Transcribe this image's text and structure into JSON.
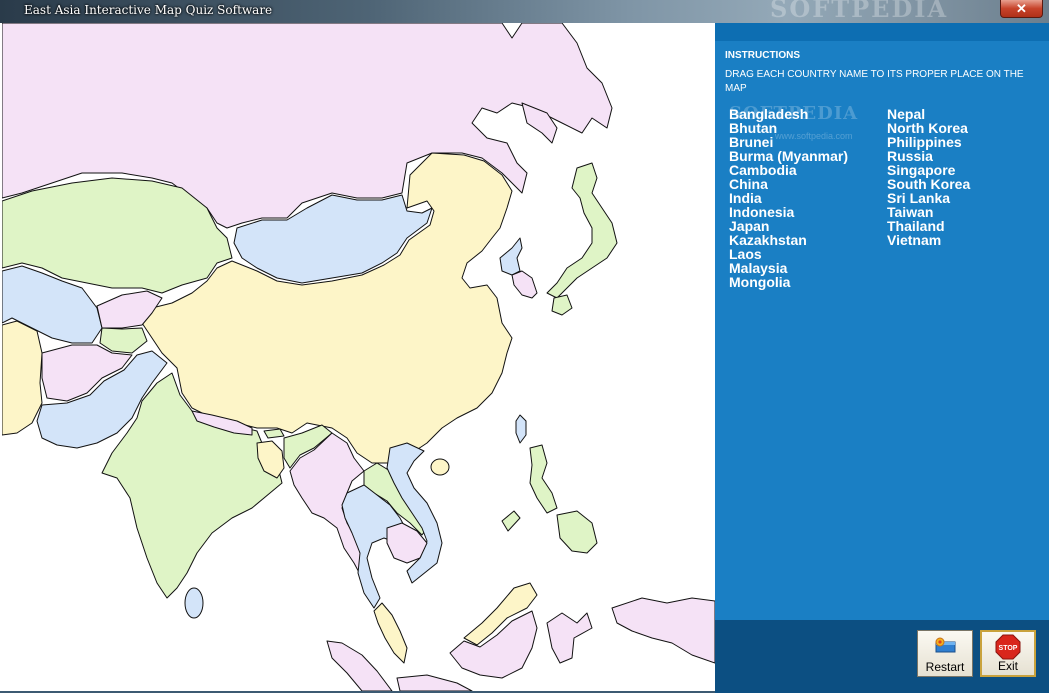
{
  "window": {
    "title": "East Asia Interactive Map Quiz Software",
    "watermark": "SOFTPEDIA",
    "close_label": "✕"
  },
  "instructions": {
    "heading": "INSTRUCTIONS",
    "text": "DRAG EACH COUNTRY NAME TO ITS PROPER PLACE ON THE MAP"
  },
  "panel_watermark": {
    "brand": "SOFTPEDIA",
    "url": "www.softpedia.com"
  },
  "countries_left": [
    "Bangladesh",
    "Bhutan",
    "Brunei",
    "Burma (Myanmar)",
    "Cambodia",
    "China",
    "India",
    "Indonesia",
    "Japan",
    "Kazakhstan",
    "Laos",
    "Malaysia",
    "Mongolia"
  ],
  "countries_right": [
    "Nepal",
    "North Korea",
    "Philippines",
    "Russia",
    "Singapore",
    "South Korea",
    "Sri Lanka",
    "Taiwan",
    "Thailand",
    "Vietnam"
  ],
  "buttons": {
    "restart_label": "Restart",
    "exit_label": "Exit",
    "stop_sign_text": "STOP"
  },
  "colors": {
    "panel_blue": "#1a7fc4",
    "bottom_bar": "#0c4f82",
    "map_pink": "#f5e2f6",
    "map_yellow": "#fdf5c8",
    "map_green": "#dff4c6",
    "map_blue": "#d3e4f9"
  },
  "icons": [
    "close-icon",
    "restart-icon",
    "stop-sign-icon"
  ]
}
